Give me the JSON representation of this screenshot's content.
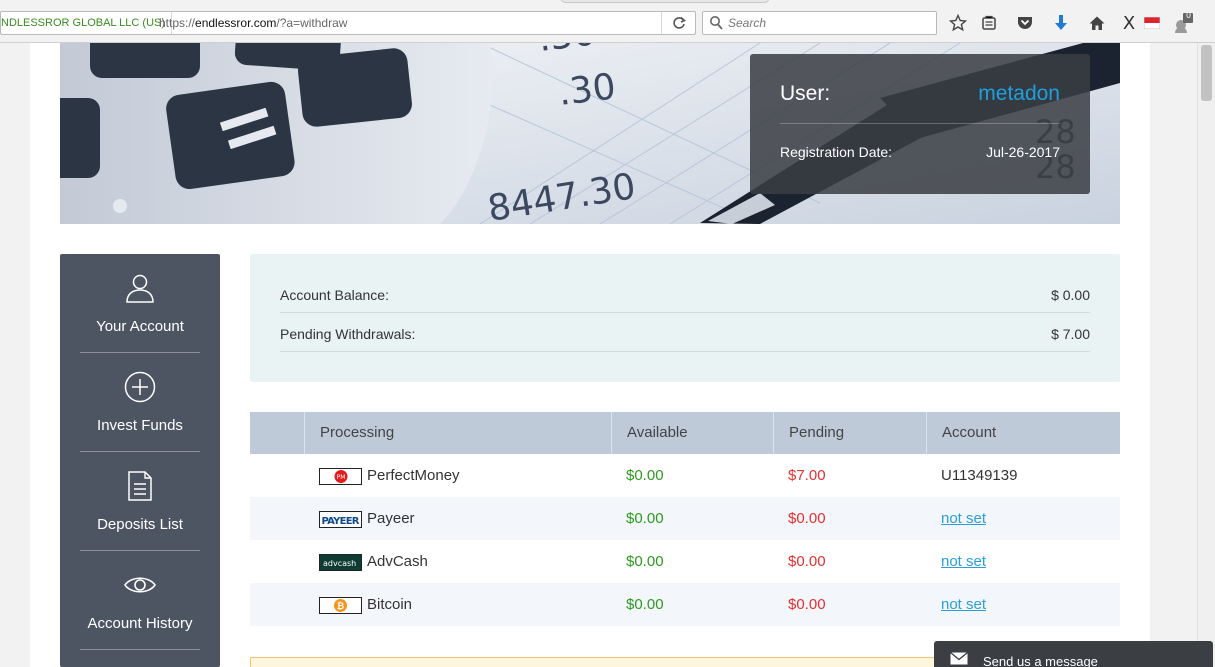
{
  "browser": {
    "site_identity": "NDLESSROR GLOBAL LLC (US)",
    "url_prefix": "https://",
    "url_domain": "endlessror.com",
    "url_path": "/?a=withdraw",
    "search_placeholder": "Search",
    "badge_count": "0",
    "icons": [
      "reload-icon",
      "search-icon",
      "bookmark-star-icon",
      "reading-list-icon",
      "pocket-icon",
      "download-arrow-icon",
      "home-icon",
      "x-extension-icon",
      "flag-icon",
      "notification-icon"
    ]
  },
  "user_box": {
    "user_label": "User:",
    "username": "metadon",
    "reg_label": "Registration Date:",
    "reg_date": "Jul-26-2017"
  },
  "sidebar": {
    "items": [
      {
        "label": "Your Account",
        "icon": "user-icon"
      },
      {
        "label": "Invest Funds",
        "icon": "plus-circle-icon"
      },
      {
        "label": "Deposits List",
        "icon": "document-icon"
      },
      {
        "label": "Account History",
        "icon": "eye-icon"
      }
    ]
  },
  "balance": {
    "account_balance_label": "Account Balance:",
    "account_balance_value": "$ 0.00",
    "pending_label": "Pending Withdrawals:",
    "pending_value": "$ 7.00"
  },
  "processors": {
    "headers": [
      "Processing",
      "Available",
      "Pending",
      "Account"
    ],
    "rows": [
      {
        "name": "PerfectMoney",
        "logo": "PM",
        "available": "$0.00",
        "pending": "$7.00",
        "account": "U11349139"
      },
      {
        "name": "Payeer",
        "logo": "PAYEER",
        "available": "$0.00",
        "pending": "$0.00",
        "account": "not set"
      },
      {
        "name": "AdvCash",
        "logo": "advcash",
        "available": "$0.00",
        "pending": "$0.00",
        "account": "not set"
      },
      {
        "name": "Bitcoin",
        "logo": "₿",
        "available": "$0.00",
        "pending": "$0.00",
        "account": "not set"
      }
    ]
  },
  "colors": {
    "accent": "#1da0de",
    "available_green": "#2e9a1e",
    "pending_red": "#e53030",
    "sidebar_bg": "#4d5563"
  },
  "chat": {
    "label": "Send us a message",
    "icon": "envelope-icon"
  }
}
